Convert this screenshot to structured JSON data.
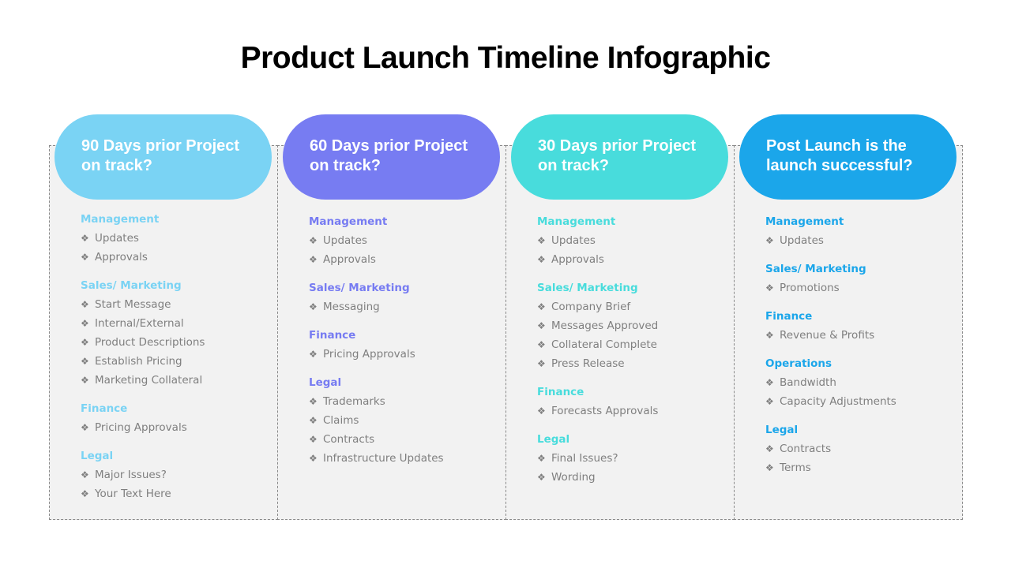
{
  "title": "Product Launch Timeline Infographic",
  "columns": [
    {
      "heading": "90 Days prior Project on track?",
      "color": "#7ad3f4",
      "sections": [
        {
          "title": "Management",
          "items": [
            "Updates",
            "Approvals"
          ]
        },
        {
          "title": "Sales/ Marketing",
          "items": [
            "Start Message",
            "Internal/External",
            "Product  Descriptions",
            "Establish Pricing",
            "Marketing  Collateral"
          ]
        },
        {
          "title": "Finance",
          "items": [
            "Pricing Approvals"
          ]
        },
        {
          "title": "Legal",
          "items": [
            "Major Issues?",
            "Your Text Here"
          ]
        }
      ]
    },
    {
      "heading": "60 Days prior Project on track?",
      "color": "#777cf2",
      "sections": [
        {
          "title": "Management",
          "items": [
            "Updates",
            "Approvals"
          ]
        },
        {
          "title": "Sales/ Marketing",
          "items": [
            "Messaging"
          ]
        },
        {
          "title": "Finance",
          "items": [
            "Pricing Approvals"
          ]
        },
        {
          "title": "Legal",
          "items": [
            "Trademarks",
            "Claims",
            "Contracts",
            "Infrastructure Updates"
          ]
        }
      ]
    },
    {
      "heading": "30 Days prior Project on track?",
      "color": "#48dcdc",
      "sections": [
        {
          "title": "Management",
          "items": [
            "Updates",
            "Approvals"
          ]
        },
        {
          "title": "Sales/ Marketing",
          "items": [
            "Company Brief",
            "Messages Approved",
            "Collateral Complete",
            "Press Release"
          ]
        },
        {
          "title": "Finance",
          "items": [
            "Forecasts Approvals"
          ]
        },
        {
          "title": "Legal",
          "items": [
            "Final Issues?",
            "Wording"
          ]
        }
      ]
    },
    {
      "heading": "Post Launch is the launch successful?",
      "color": "#1ba6ea",
      "sections": [
        {
          "title": "Management",
          "items": [
            "Updates"
          ]
        },
        {
          "title": "Sales/ Marketing",
          "items": [
            "Promotions"
          ]
        },
        {
          "title": "Finance",
          "items": [
            "Revenue & Profits"
          ]
        },
        {
          "title": "Operations",
          "items": [
            "Bandwidth",
            "Capacity Adjustments"
          ]
        },
        {
          "title": "Legal",
          "items": [
            "Contracts",
            "Terms"
          ]
        }
      ]
    }
  ],
  "bullet_icon": "❖"
}
